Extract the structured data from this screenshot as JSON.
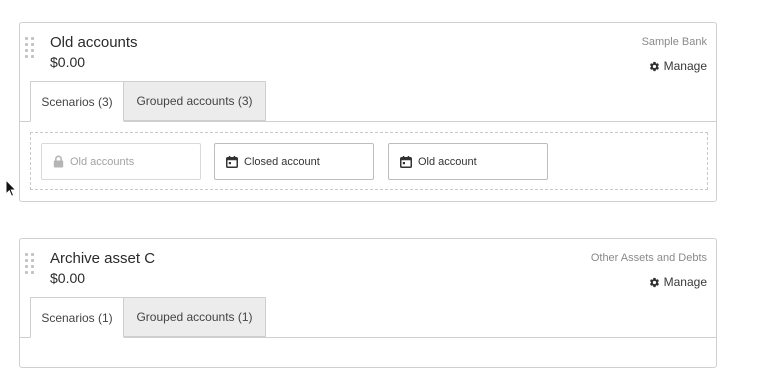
{
  "accounts": [
    {
      "title": "Old accounts",
      "amount": "$0.00",
      "institution": "Sample Bank",
      "manage_label": "Manage",
      "tabs": [
        {
          "label": "Scenarios (3)",
          "active": true
        },
        {
          "label": "Grouped accounts (3)",
          "active": false
        }
      ],
      "scenarios": [
        {
          "label": "Old accounts",
          "icon": "lock-icon",
          "locked": true
        },
        {
          "label": "Closed account",
          "icon": "calendar-icon",
          "locked": false
        },
        {
          "label": "Old account",
          "icon": "calendar-icon",
          "locked": false
        }
      ]
    },
    {
      "title": "Archive asset C",
      "amount": "$0.00",
      "institution": "Other Assets and Debts",
      "manage_label": "Manage",
      "tabs": [
        {
          "label": "Scenarios (1)",
          "active": true
        },
        {
          "label": "Grouped accounts (1)",
          "active": false
        }
      ]
    }
  ],
  "icons": {
    "drag": "drag-handle-icon",
    "manage": "gear-icon",
    "locked_scenario": "lock-icon",
    "scenario": "calendar-icon",
    "cursor": "mouse-pointer-icon"
  },
  "colors": {
    "card_border": "#cfcfcf",
    "inactive_tab_bg": "#ececec",
    "muted_text": "#8a8a8a",
    "locked_text": "#a3a3a3",
    "body_text": "#2f2f2f"
  }
}
